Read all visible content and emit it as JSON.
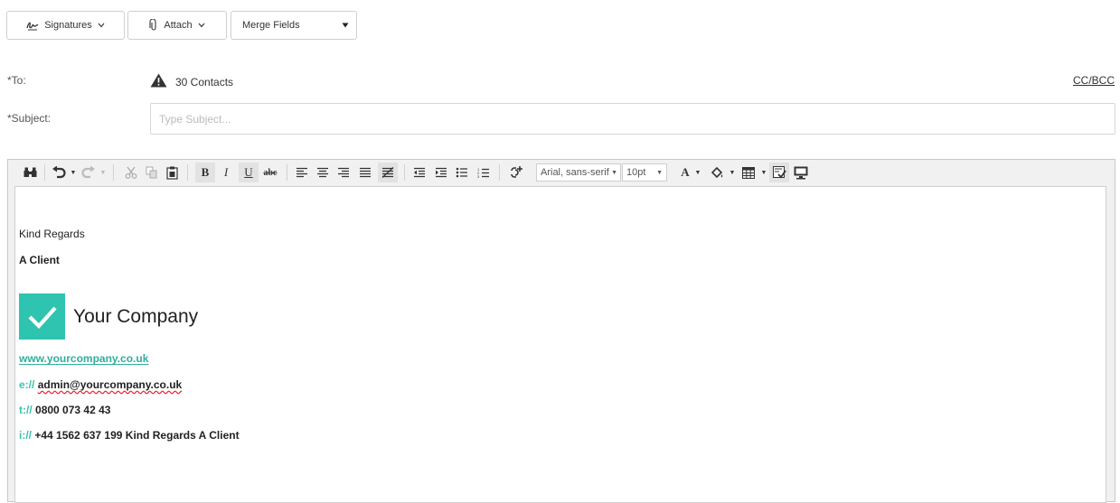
{
  "toolbar": {
    "signatures_label": "Signatures",
    "attach_label": "Attach",
    "merge_fields_label": "Merge Fields"
  },
  "to": {
    "label": "*To:",
    "value": "30 Contacts",
    "cc_bcc_label": "CC/BCC"
  },
  "subject": {
    "label": "*Subject:",
    "placeholder": "Type Subject...",
    "value": ""
  },
  "editor": {
    "font_family": "Arial, sans-serif",
    "font_size": "10pt"
  },
  "body": {
    "line1": "Kind Regards",
    "line2": "A Client",
    "logo_text": "Your Company",
    "website": "www.yourcompany.co.uk",
    "email_prefix": "e://",
    "email": "admin@yourcompany.co.uk",
    "phone_prefix": "t://",
    "phone": "0800 073 42 43",
    "intl_prefix": "i://",
    "intl": "+44 1562 637 199 Kind Regards A Client"
  },
  "colors": {
    "accent": "#2ec4b0",
    "link": "#2fae9d",
    "warning_icon": "#333333"
  }
}
